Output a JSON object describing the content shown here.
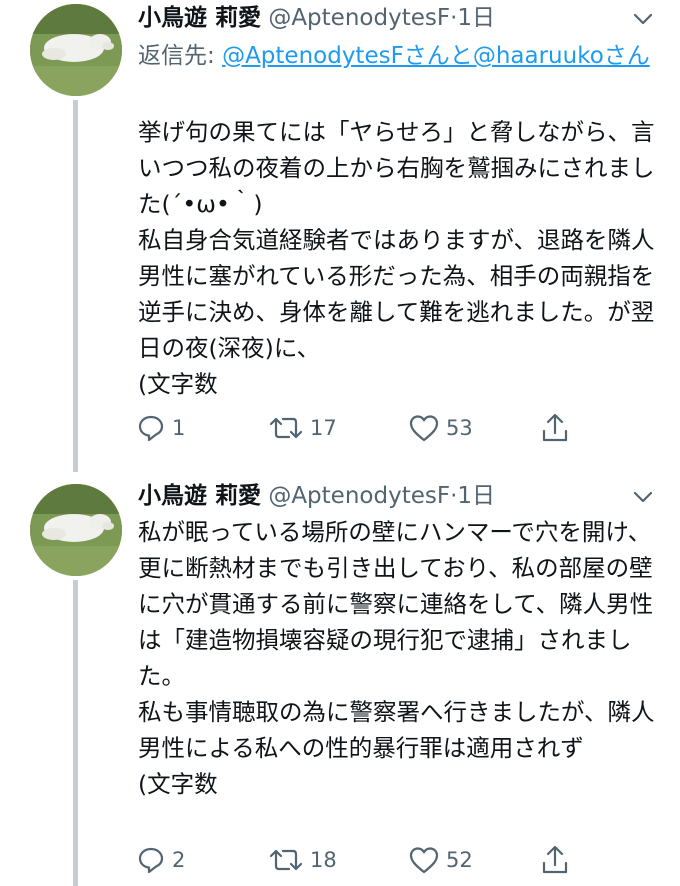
{
  "tweets": [
    {
      "author": {
        "name": "小鳥遊 莉愛",
        "handle": "@AptenodytesF"
      },
      "separator": "·",
      "time": "1日",
      "reply_to": {
        "prefix": "返信先: ",
        "user1": "@AptenodytesFさんと",
        "user2": "@haaruuko",
        "suffix": "さん"
      },
      "body": [
        "挙げ句の果てには「ヤらせろ」と脅しながら、言いつつ私の夜着の上から右胸を鷲掴みにされました(´•ω•｀)",
        "私自身合気道経験者ではありますが、退路を隣人男性に塞がれている形だった為、相手の両親指を逆手に決め、身体を離して難を逃れました。が翌日の夜(深夜)に、",
        "(文字数"
      ],
      "actions": {
        "reply_count": "1",
        "retweet_count": "17",
        "like_count": "53"
      },
      "icons": {
        "avatar": "avatar",
        "menu": "chevron-down-icon",
        "reply": "reply-icon",
        "retweet": "retweet-icon",
        "like": "heart-icon",
        "share": "share-icon"
      }
    },
    {
      "author": {
        "name": "小鳥遊 莉愛",
        "handle": "@AptenodytesF"
      },
      "separator": "·",
      "time": "1日",
      "body": [
        "私が眠っている場所の壁にハンマーで穴を開け、更に断熱材までも引き出しており、私の部屋の壁に穴が貫通する前に警察に連絡をして、隣人男性は「建造物損壊容疑の現行犯で逮捕」されました。",
        "私も事情聴取の為に警察署へ行きましたが、隣人男性による私への性的暴行罪は適用されず",
        "(文字数"
      ],
      "actions": {
        "reply_count": "2",
        "retweet_count": "18",
        "like_count": "52"
      },
      "icons": {
        "avatar": "avatar",
        "menu": "chevron-down-icon",
        "reply": "reply-icon",
        "retweet": "retweet-icon",
        "like": "heart-icon",
        "share": "share-icon"
      }
    }
  ],
  "colors": {
    "text": "#0f1419",
    "secondary": "#536471",
    "link": "#1d9bf0",
    "thread_line": "#c4cdd6"
  }
}
